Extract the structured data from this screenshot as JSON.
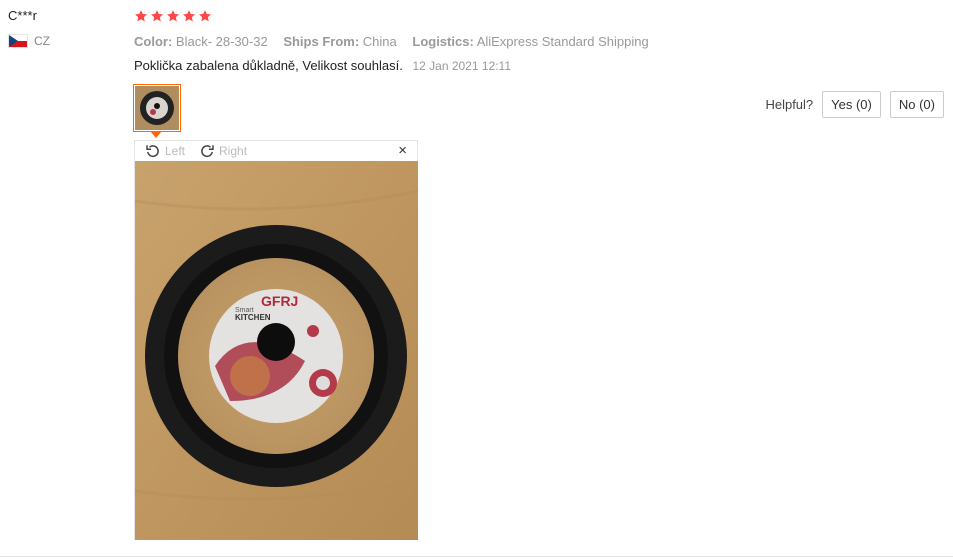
{
  "reviewer": {
    "name": "C***r",
    "country": "CZ"
  },
  "rating": 5,
  "attributes": [
    {
      "label": "Color:",
      "value": "Black- 28-30-32"
    },
    {
      "label": "Ships From:",
      "value": "China"
    },
    {
      "label": "Logistics:",
      "value": "AliExpress Standard Shipping"
    }
  ],
  "review": {
    "text": "Poklička zabalena důkladně, Velikost souhlasí.",
    "date": "12 Jan 2021 12:11"
  },
  "helpful": {
    "label": "Helpful?",
    "yes": "Yes (0)",
    "no": "No (0)"
  },
  "viewer": {
    "rotate_left": "Left",
    "rotate_right": "Right",
    "close": "×"
  },
  "photo": {
    "brand": "GFRJ",
    "text1": "Smart",
    "text2": "KITCHEN"
  },
  "colors": {
    "star": "#ff4747",
    "accent": "#ff6600"
  }
}
